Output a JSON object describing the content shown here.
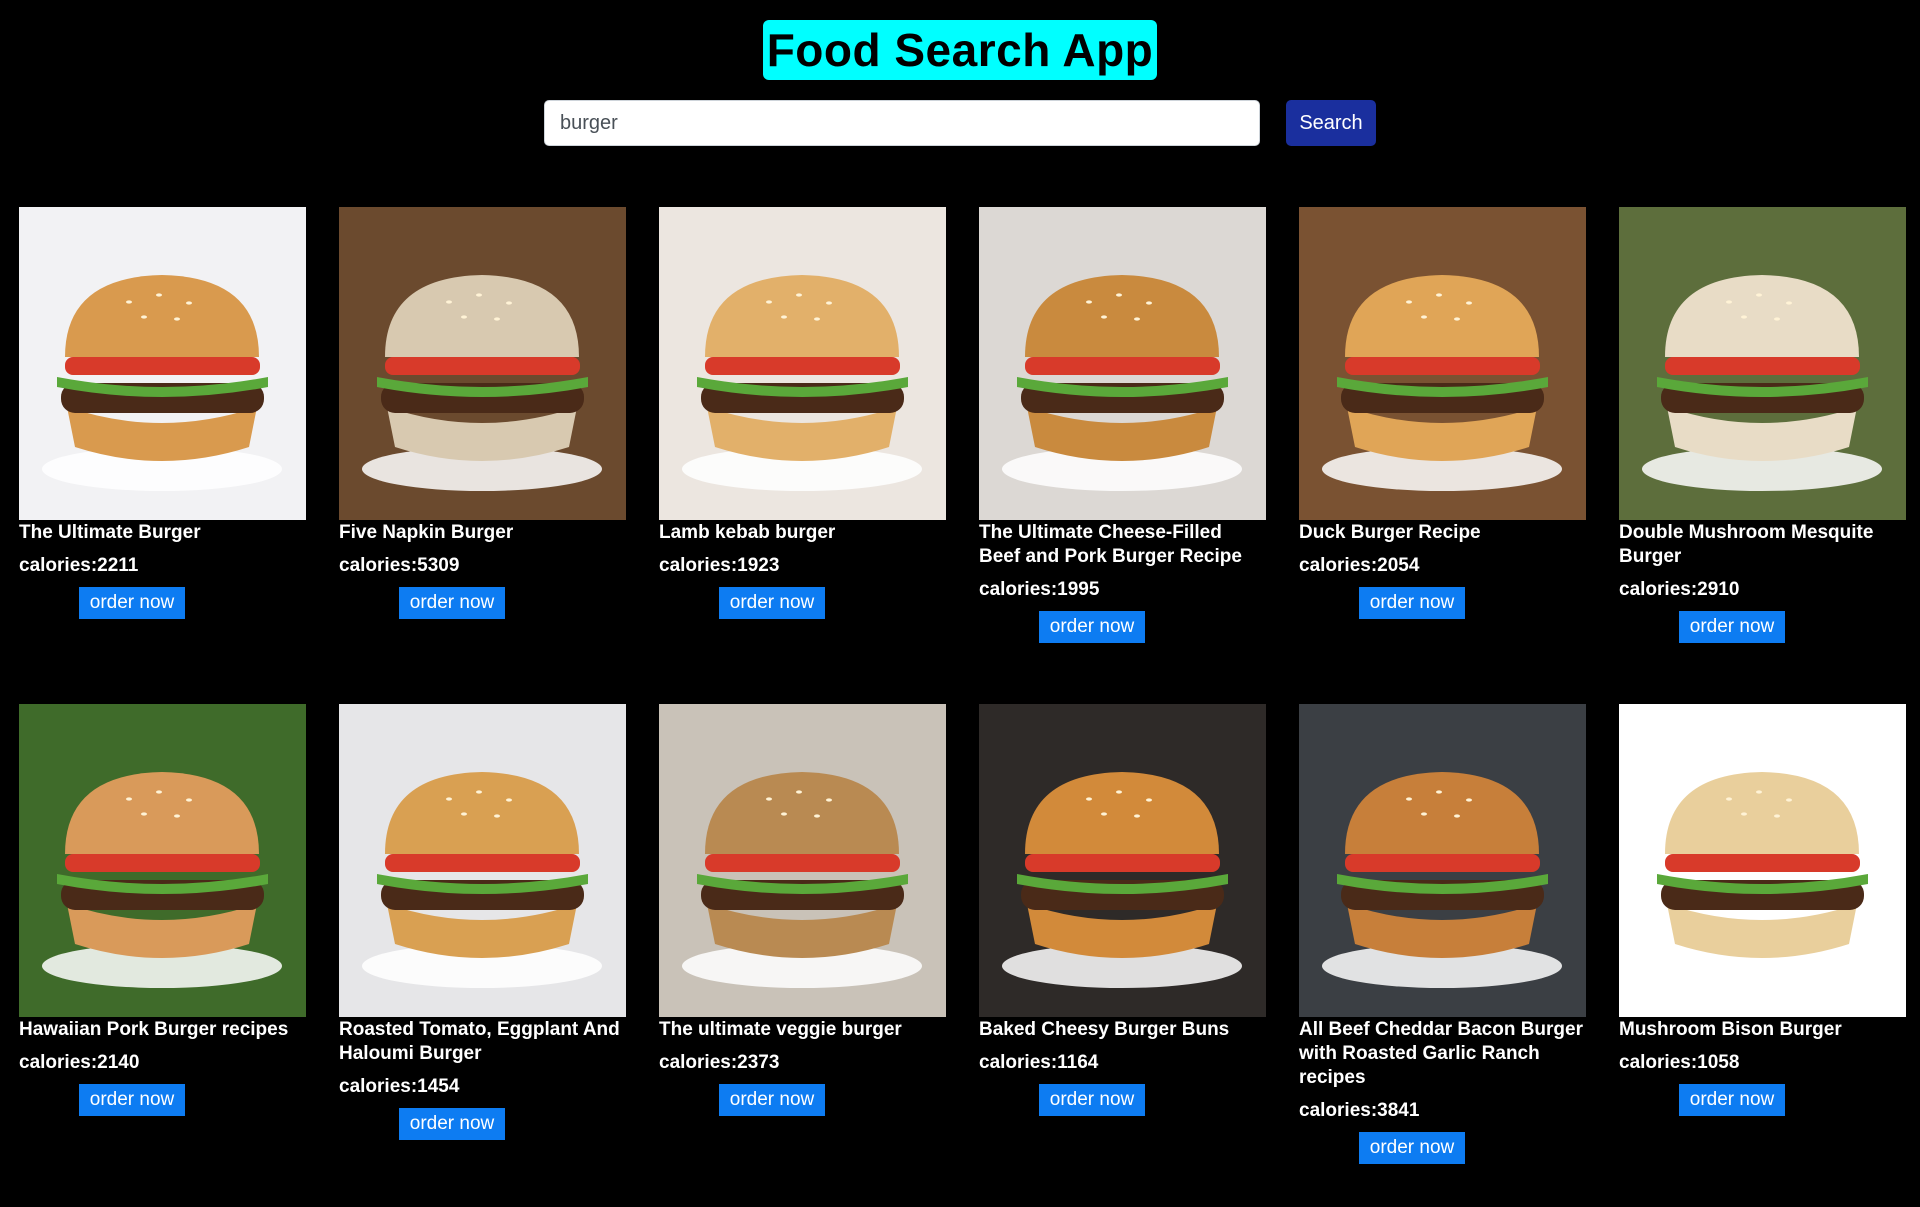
{
  "app": {
    "title": "Food Search App"
  },
  "search": {
    "value": "burger",
    "button_label": "Search"
  },
  "recipes": [
    {
      "title": "The Ultimate Burger",
      "calories": "calories:2211",
      "order_label": "order now",
      "bg": "#f2f2f4",
      "bun": "#d99a4e"
    },
    {
      "title": "Five Napkin Burger",
      "calories": "calories:5309",
      "order_label": "order now",
      "bg": "#6b4a2e",
      "bun": "#d8c9b0"
    },
    {
      "title": "Lamb kebab burger",
      "calories": "calories:1923",
      "order_label": "order now",
      "bg": "#ece6e0",
      "bun": "#e2b06a"
    },
    {
      "title": "The Ultimate Cheese-Filled Beef and Pork Burger Recipe",
      "calories": "calories:1995",
      "order_label": "order now",
      "bg": "#dcd8d4",
      "bun": "#c98a3e"
    },
    {
      "title": "Duck Burger Recipe",
      "calories": "calories:2054",
      "order_label": "order now",
      "bg": "#7a5232",
      "bun": "#e0a557"
    },
    {
      "title": "Double Mushroom Mesquite Burger",
      "calories": "calories:2910",
      "order_label": "order now",
      "bg": "#5d6e3c",
      "bun": "#e8dcc6"
    },
    {
      "title": "Hawaiian Pork Burger recipes",
      "calories": "calories:2140",
      "order_label": "order now",
      "bg": "#3f6b2a",
      "bun": "#d99a5a"
    },
    {
      "title": "Roasted Tomato, Eggplant And Haloumi Burger",
      "calories": "calories:1454",
      "order_label": "order now",
      "bg": "#e6e6e8",
      "bun": "#d9a052"
    },
    {
      "title": "The ultimate veggie burger",
      "calories": "calories:2373",
      "order_label": "order now",
      "bg": "#c9c2b8",
      "bun": "#b98a52"
    },
    {
      "title": "Baked Cheesy Burger Buns",
      "calories": "calories:1164",
      "order_label": "order now",
      "bg": "#2e2a28",
      "bun": "#d28a3a"
    },
    {
      "title": "All Beef Cheddar Bacon Burger with Roasted Garlic Ranch recipes",
      "calories": "calories:3841",
      "order_label": "order now",
      "bg": "#3b3f44",
      "bun": "#c77f3a"
    },
    {
      "title": "Mushroom Bison Burger",
      "calories": "calories:1058",
      "order_label": "order now",
      "bg": "#ffffff",
      "bun": "#e9cf9c"
    }
  ]
}
